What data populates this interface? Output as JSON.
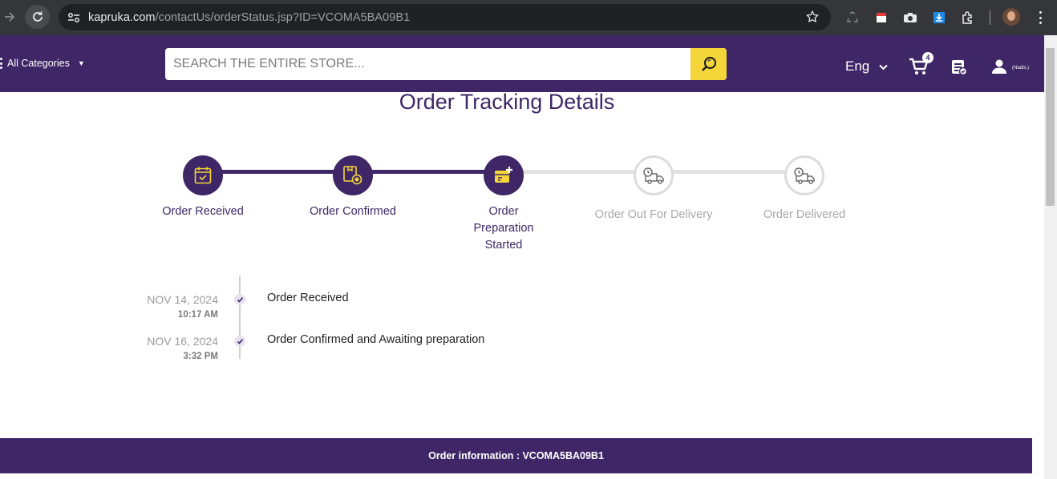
{
  "browser": {
    "url_host": "kapruka.com",
    "url_path": "/contactUs/orderStatus.jsp?ID=VCOMA5BA09B1"
  },
  "header": {
    "categories_label": "All Categories",
    "search_placeholder": "SEARCH THE ENTIRE STORE...",
    "language": "Eng",
    "cart_count": "4",
    "user_name": "(Nadis.)",
    "brand_color": "#3f2767",
    "accent_color": "#f5d63a"
  },
  "page": {
    "title": "Order Tracking Details"
  },
  "steps": [
    {
      "label": "Order Received",
      "status": "done",
      "icon": "calendar-check-icon"
    },
    {
      "label": "Order Confirmed",
      "status": "done",
      "icon": "box-badge-icon"
    },
    {
      "label": "Order Preparation Started",
      "status": "done",
      "icon": "package-plus-icon"
    },
    {
      "label": "Order Out For Delivery",
      "status": "pending",
      "icon": "delivery-truck-icon"
    },
    {
      "label": "Order Delivered",
      "status": "pending",
      "icon": "delivered-truck-icon"
    }
  ],
  "timeline": [
    {
      "date": "NOV 14, 2024",
      "time": "10:17 AM",
      "text": "Order Received"
    },
    {
      "date": "NOV 16, 2024",
      "time": "3:32 PM",
      "text": "Order Confirmed and Awaiting preparation"
    }
  ],
  "order_info": {
    "label": "Order information : VCOMA5BA09B1"
  }
}
